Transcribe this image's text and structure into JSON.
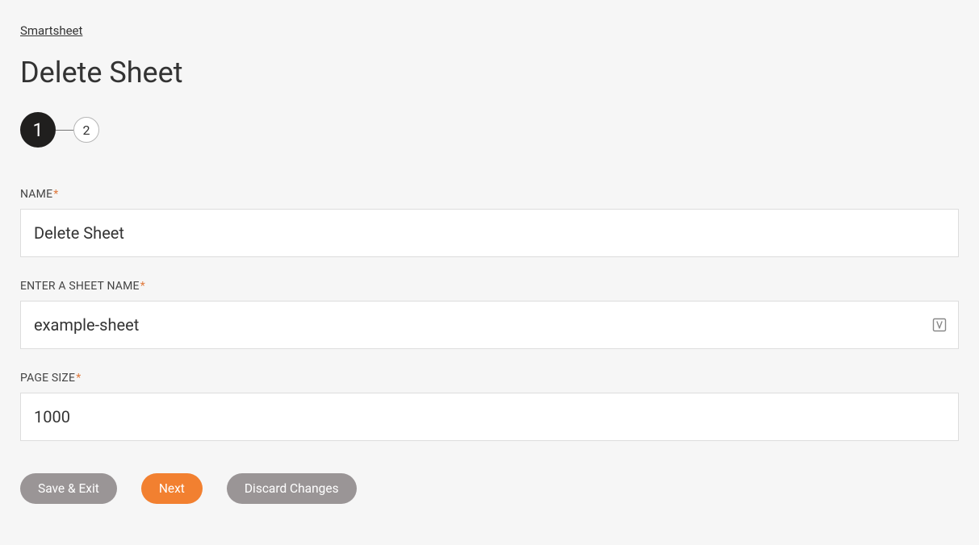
{
  "breadcrumb": {
    "label": "Smartsheet"
  },
  "page": {
    "title": "Delete Sheet"
  },
  "stepper": {
    "steps": [
      {
        "label": "1",
        "active": true
      },
      {
        "label": "2",
        "active": false
      }
    ]
  },
  "form": {
    "name": {
      "label": "NAME",
      "value": "Delete Sheet"
    },
    "sheetName": {
      "label": "ENTER A SHEET NAME",
      "value": "example-sheet"
    },
    "pageSize": {
      "label": "PAGE SIZE",
      "value": "1000"
    }
  },
  "buttons": {
    "saveExit": "Save & Exit",
    "next": "Next",
    "discard": "Discard Changes"
  }
}
